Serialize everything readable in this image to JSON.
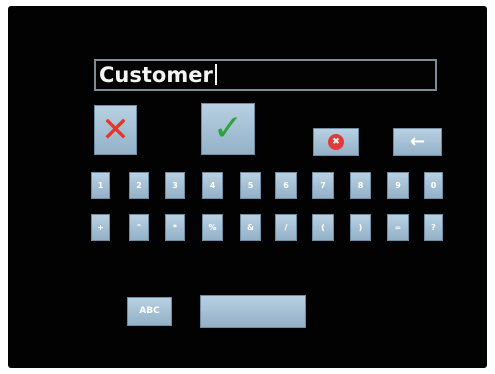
{
  "input": {
    "value": "Customer"
  },
  "action_keys": {
    "cancel_glyph": "✕",
    "confirm_glyph": "✓",
    "clear_glyph": "✖",
    "backspace_glyph": "←",
    "cancel_color": "#e8322c",
    "confirm_color": "#2fa23a",
    "clear_color": "#e23a3a"
  },
  "digit_row": [
    "1",
    "2",
    "3",
    "4",
    "5",
    "6",
    "7",
    "8",
    "9",
    "0"
  ],
  "symbol_row": [
    "+",
    "\"",
    "*",
    "%",
    "&",
    "/",
    "(",
    ")",
    "=",
    "?"
  ],
  "bottom": {
    "abc_label": "ABC",
    "space_label": ""
  }
}
